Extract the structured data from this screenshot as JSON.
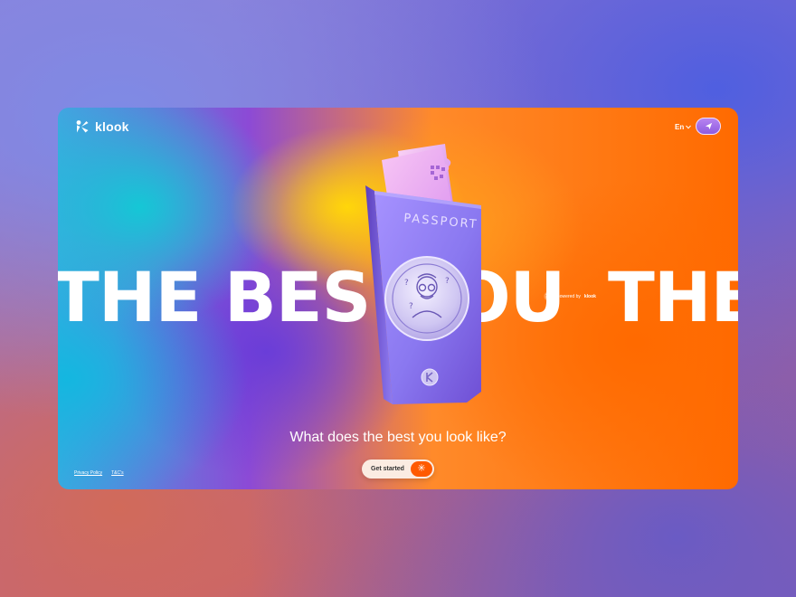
{
  "header": {
    "brand": "klook",
    "language": "En",
    "lang_chevron_icon": "chevron-down-icon",
    "plane_icon": "paper-plane-icon"
  },
  "hero": {
    "marquee_left": "THE BES",
    "marquee_mid": "OU",
    "marquee_right": "THE",
    "powered_prefix": "powered by",
    "powered_brand": "klook",
    "passport_title": "PASSPORT"
  },
  "main": {
    "question": "What does the best you look like?",
    "cta_label": "Get started",
    "cta_icon": "asterisk-icon",
    "cta_glyph": "✳"
  },
  "footer": {
    "privacy": "Privacy Policy",
    "tcs": "T&C's"
  },
  "colors": {
    "accent_orange": "#ff5a00",
    "accent_purple": "#8e5be0"
  }
}
